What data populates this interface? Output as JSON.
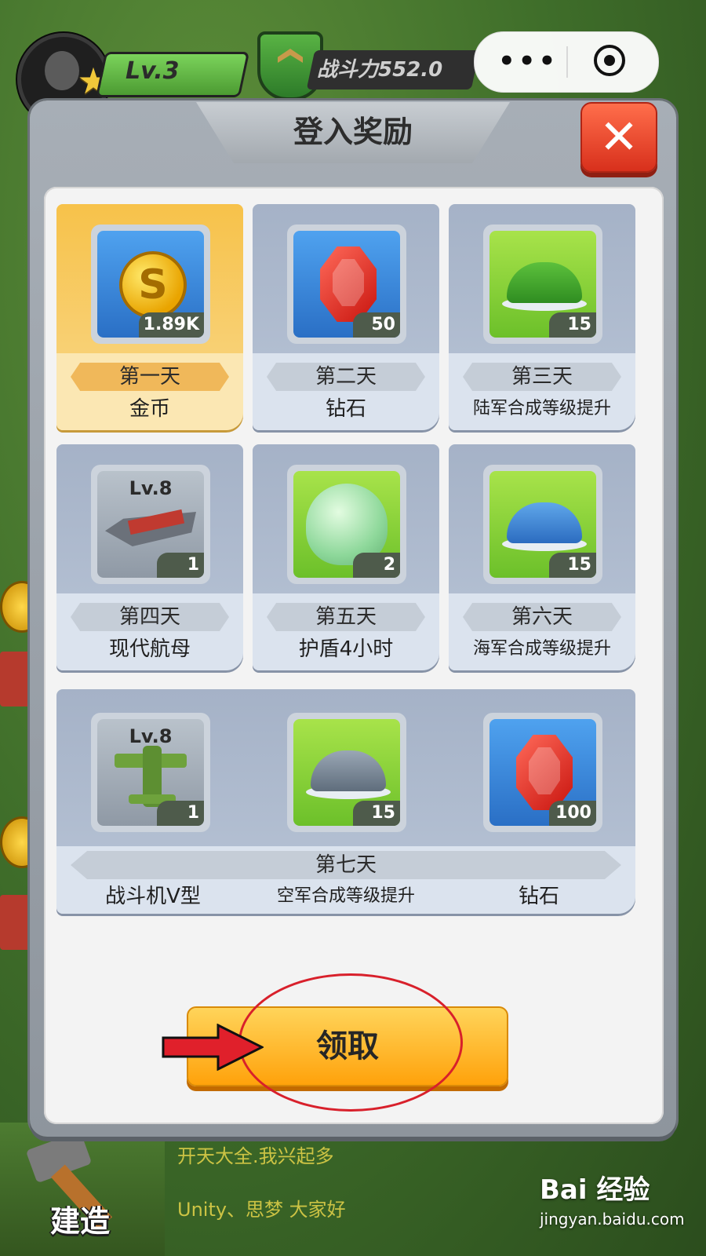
{
  "top_bar": {
    "level": "Lv.3",
    "power": "战斗力552.0",
    "capsule_more": "•••"
  },
  "background": {
    "build_label": "建造",
    "chat_line_1": "开天大全.我兴起多",
    "chat_line_2": "Unity、思梦 大家好",
    "watermark_logo": "Bai 经验",
    "watermark_url": "jingyan.baidu.com"
  },
  "dialog": {
    "title": "登入奖励",
    "close_glyph": "✕",
    "claim_label": "领取",
    "days": [
      {
        "day": "第一天",
        "name": "金币",
        "count": "1.89K",
        "icon": "gold-coin-icon",
        "bg": "blue",
        "highlight": true
      },
      {
        "day": "第二天",
        "name": "钻石",
        "count": "50",
        "icon": "red-gem-icon",
        "bg": "blue",
        "highlight": false
      },
      {
        "day": "第三天",
        "name": "陆军合成等级提升",
        "count": "15",
        "icon": "green-helmet-icon",
        "bg": "green",
        "highlight": false
      },
      {
        "day": "第四天",
        "name": "现代航母",
        "count": "1",
        "lv": "Lv.8",
        "icon": "aircraft-carrier-icon",
        "bg": "gray",
        "highlight": false
      },
      {
        "day": "第五天",
        "name": "护盾4小时",
        "count": "2",
        "icon": "shield-bubble-icon",
        "bg": "green",
        "highlight": false
      },
      {
        "day": "第六天",
        "name": "海军合成等级提升",
        "count": "15",
        "icon": "blue-helmet-icon",
        "bg": "green",
        "highlight": false
      }
    ],
    "day7": {
      "day": "第七天",
      "items": [
        {
          "name": "战斗机V型",
          "count": "1",
          "lv": "Lv.8",
          "icon": "fighter-plane-icon",
          "bg": "gray"
        },
        {
          "name": "空军合成等级提升",
          "count": "15",
          "icon": "gray-helmet-icon",
          "bg": "green"
        },
        {
          "name": "钻石",
          "count": "100",
          "icon": "red-gem-icon",
          "bg": "blue"
        }
      ]
    }
  },
  "colors": {
    "highlight": "#f7c24a",
    "claim": "#ffa20b",
    "close": "#d8301c",
    "annotation": "#d8202b"
  }
}
